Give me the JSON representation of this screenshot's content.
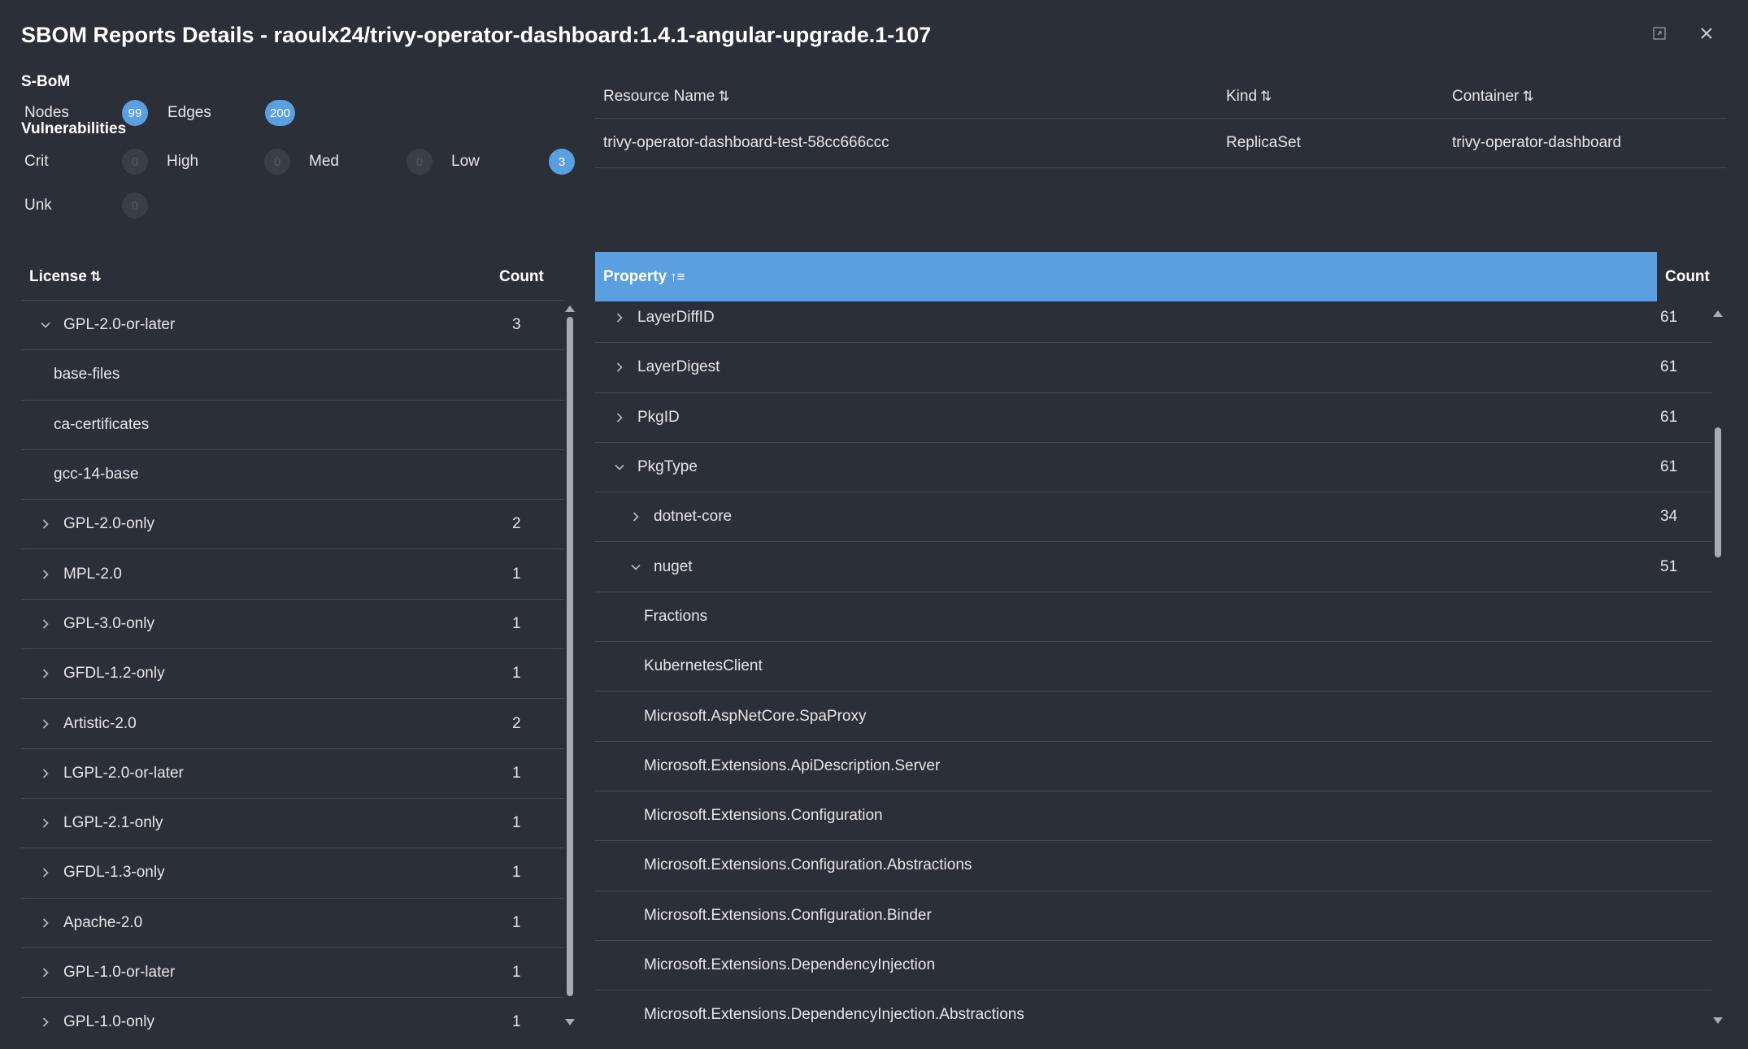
{
  "dialog": {
    "title": "SBOM Reports Details - raoulx24/trivy-operator-dashboard:1.4.1-angular-upgrade.1-107",
    "icons": [
      "expand-icon",
      "close-icon"
    ]
  },
  "sbom": {
    "heading": "S-BoM",
    "nodes_label": "Nodes",
    "nodes_value": "99",
    "edges_label": "Edges",
    "edges_value": "200"
  },
  "vulns": {
    "heading": "Vulnerabilities",
    "crit_label": "Crit",
    "crit_value": "0",
    "high_label": "High",
    "high_value": "0",
    "med_label": "Med",
    "med_value": "0",
    "low_label": "Low",
    "low_value": "3",
    "unk_label": "Unk",
    "unk_value": "0"
  },
  "resource_table": {
    "headers": {
      "name": "Resource Name",
      "kind": "Kind",
      "container": "Container"
    },
    "row": {
      "name": "trivy-operator-dashboard-test-58cc666ccc",
      "kind": "ReplicaSet",
      "container": "trivy-operator-dashboard"
    }
  },
  "license_table": {
    "headers": {
      "license": "License",
      "count": "Count"
    },
    "rows": [
      {
        "label": "GPL-2.0-or-later",
        "count": "3",
        "level": 0,
        "state": "expanded"
      },
      {
        "label": "base-files",
        "count": "",
        "level": 1,
        "state": "leaf"
      },
      {
        "label": "ca-certificates",
        "count": "",
        "level": 1,
        "state": "leaf"
      },
      {
        "label": "gcc-14-base",
        "count": "",
        "level": 1,
        "state": "leaf"
      },
      {
        "label": "GPL-2.0-only",
        "count": "2",
        "level": 0,
        "state": "collapsed"
      },
      {
        "label": "MPL-2.0",
        "count": "1",
        "level": 0,
        "state": "collapsed"
      },
      {
        "label": "GPL-3.0-only",
        "count": "1",
        "level": 0,
        "state": "collapsed"
      },
      {
        "label": "GFDL-1.2-only",
        "count": "1",
        "level": 0,
        "state": "collapsed"
      },
      {
        "label": "Artistic-2.0",
        "count": "2",
        "level": 0,
        "state": "collapsed"
      },
      {
        "label": "LGPL-2.0-or-later",
        "count": "1",
        "level": 0,
        "state": "collapsed"
      },
      {
        "label": "LGPL-2.1-only",
        "count": "1",
        "level": 0,
        "state": "collapsed"
      },
      {
        "label": "GFDL-1.3-only",
        "count": "1",
        "level": 0,
        "state": "collapsed"
      },
      {
        "label": "Apache-2.0",
        "count": "1",
        "level": 0,
        "state": "collapsed"
      },
      {
        "label": "GPL-1.0-or-later",
        "count": "1",
        "level": 0,
        "state": "collapsed"
      },
      {
        "label": "GPL-1.0-only",
        "count": "1",
        "level": 0,
        "state": "collapsed"
      }
    ]
  },
  "property_table": {
    "headers": {
      "property": "Property",
      "count": "Count"
    },
    "rows": [
      {
        "label": "LayerDiffID",
        "count": "61",
        "level": 0,
        "state": "collapsed"
      },
      {
        "label": "LayerDigest",
        "count": "61",
        "level": 0,
        "state": "collapsed"
      },
      {
        "label": "PkgID",
        "count": "61",
        "level": 0,
        "state": "collapsed"
      },
      {
        "label": "PkgType",
        "count": "61",
        "level": 0,
        "state": "expanded"
      },
      {
        "label": "dotnet-core",
        "count": "34",
        "level": 1,
        "state": "collapsed"
      },
      {
        "label": "nuget",
        "count": "51",
        "level": 1,
        "state": "expanded"
      },
      {
        "label": "Fractions",
        "count": "",
        "level": 2,
        "state": "leaf"
      },
      {
        "label": "KubernetesClient",
        "count": "",
        "level": 2,
        "state": "leaf"
      },
      {
        "label": "Microsoft.AspNetCore.SpaProxy",
        "count": "",
        "level": 2,
        "state": "leaf"
      },
      {
        "label": "Microsoft.Extensions.ApiDescription.Server",
        "count": "",
        "level": 2,
        "state": "leaf"
      },
      {
        "label": "Microsoft.Extensions.Configuration",
        "count": "",
        "level": 2,
        "state": "leaf"
      },
      {
        "label": "Microsoft.Extensions.Configuration.Abstractions",
        "count": "",
        "level": 2,
        "state": "leaf"
      },
      {
        "label": "Microsoft.Extensions.Configuration.Binder",
        "count": "",
        "level": 2,
        "state": "leaf"
      },
      {
        "label": "Microsoft.Extensions.DependencyInjection",
        "count": "",
        "level": 2,
        "state": "leaf"
      },
      {
        "label": "Microsoft.Extensions.DependencyInjection.Abstractions",
        "count": "",
        "level": 2,
        "state": "leaf"
      }
    ]
  },
  "colors": {
    "accent": "#5a9fe0",
    "background": "#2b2f37",
    "border": "#454a53"
  }
}
